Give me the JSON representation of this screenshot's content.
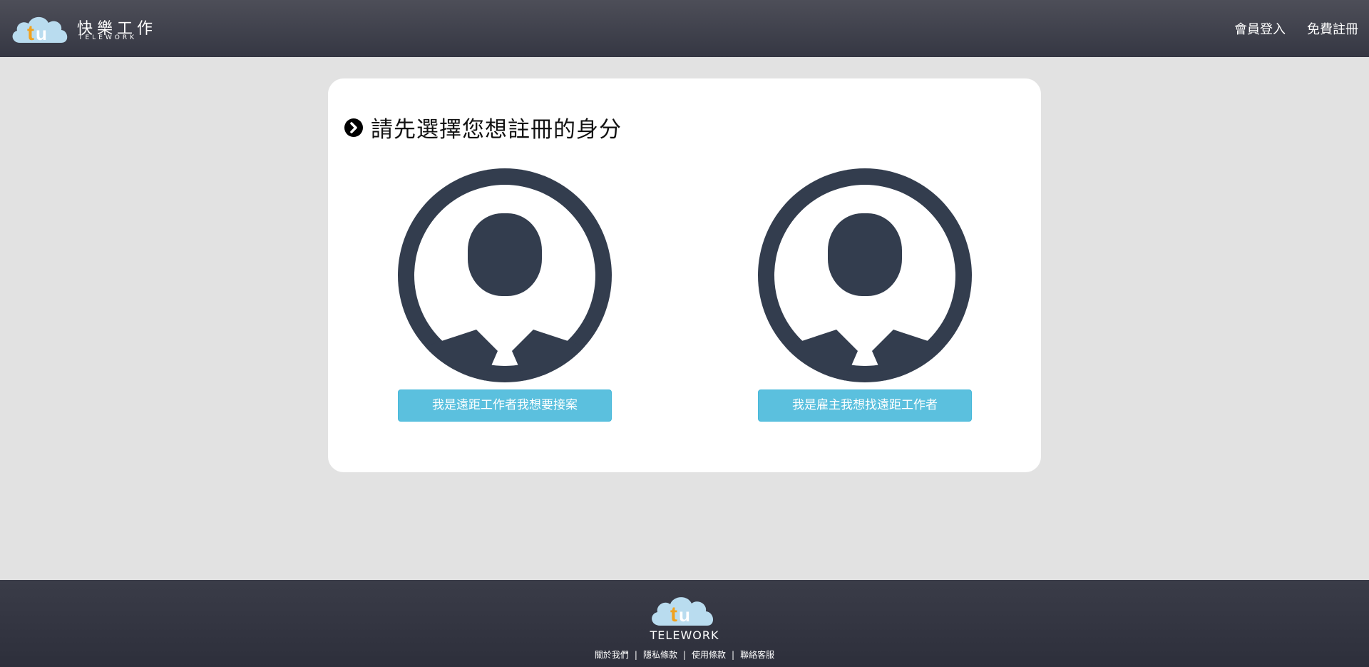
{
  "header": {
    "logo_title": "快樂工作",
    "logo_subtitle": "TELEWORK",
    "nav": {
      "login_label": "會員登入",
      "register_label": "免費註冊"
    }
  },
  "main": {
    "title": "請先選擇您想註冊的身分",
    "choices": [
      {
        "label": "我是遠距工作者我想要接案",
        "icon": "user-avatar-icon"
      },
      {
        "label": "我是雇主我想找遠距工作者",
        "icon": "user-avatar-icon"
      }
    ]
  },
  "footer": {
    "brand": "TELEWORK",
    "links": [
      "關於我們",
      "隱私條款",
      "使用條款",
      "聯絡客服"
    ],
    "separator": "|"
  },
  "colors": {
    "header_bg": "#42434e",
    "page_bg": "#e2e2e2",
    "button": "#5bc0de",
    "avatar": "#333d4e",
    "cloud": "#b9dcef",
    "logo_t": "#f0a21f"
  }
}
